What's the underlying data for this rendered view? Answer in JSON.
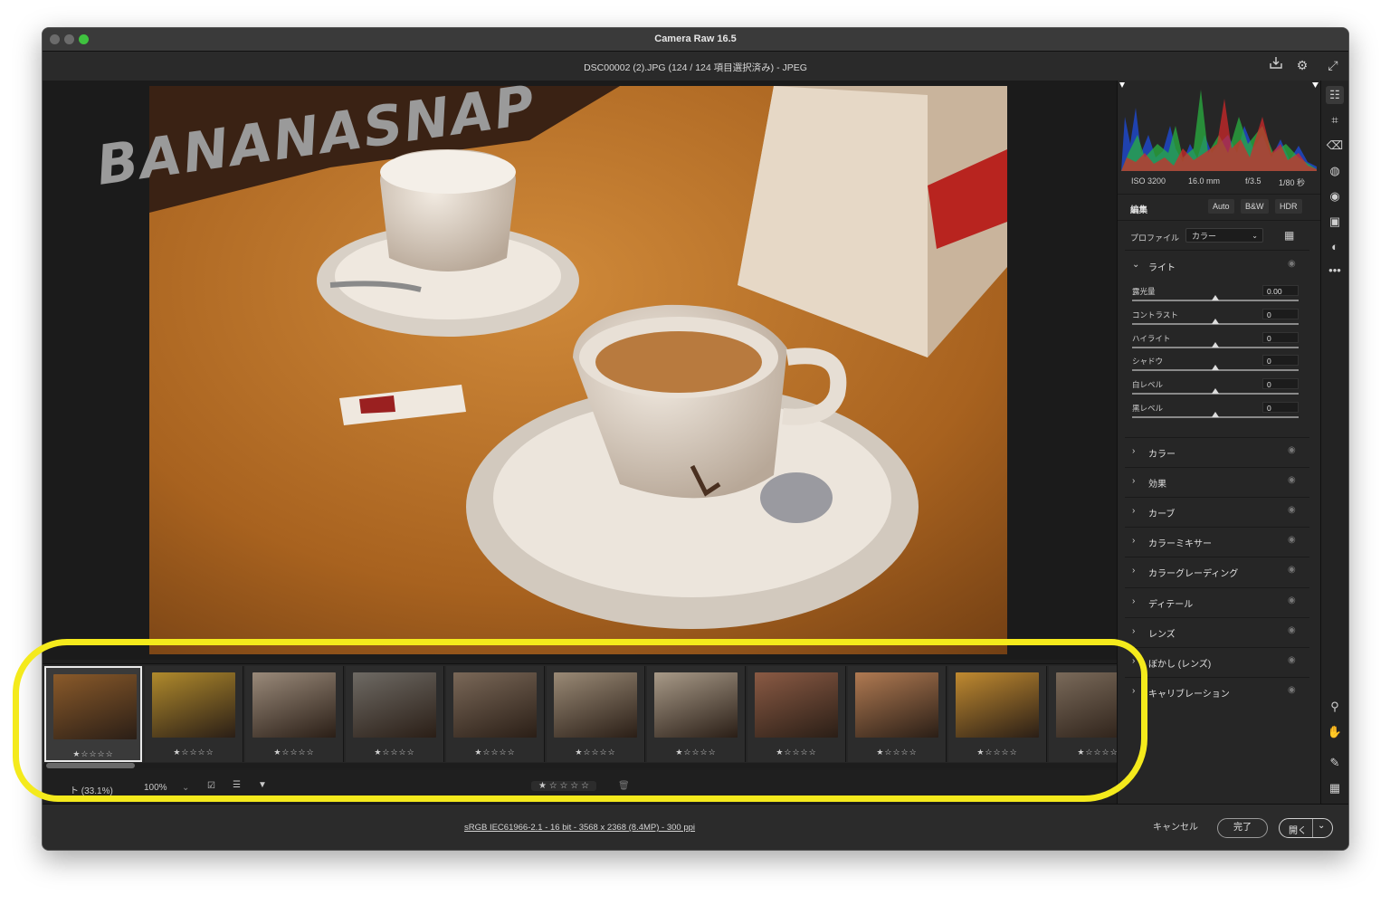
{
  "window": {
    "title": "Camera Raw 16.5",
    "filename": "DSC00002 (2).JPG (124 / 124 項目選択済み)  -  JPEG"
  },
  "watermark": "BANANASNAP",
  "filmstrip": {
    "thumbnails": [
      {
        "stars": "★☆☆☆☆",
        "color": "#8a5a2a",
        "selected": true
      },
      {
        "stars": "★☆☆☆☆",
        "color": "#b08a2c"
      },
      {
        "stars": "★☆☆☆☆",
        "color": "#9a8a7a"
      },
      {
        "stars": "★☆☆☆☆",
        "color": "#6e6a64"
      },
      {
        "stars": "★☆☆☆☆",
        "color": "#7a6858"
      },
      {
        "stars": "★☆☆☆☆",
        "color": "#9a8a76"
      },
      {
        "stars": "★☆☆☆☆",
        "color": "#a89a88"
      },
      {
        "stars": "★☆☆☆☆",
        "color": "#8a5a44"
      },
      {
        "stars": "★☆☆☆☆",
        "color": "#b07a52"
      },
      {
        "stars": "★☆☆☆☆",
        "color": "#c08a30"
      },
      {
        "stars": "★☆☆☆☆",
        "color": "#7a6a5a"
      }
    ]
  },
  "bottom": {
    "fit_zoom": "ト (33.1%)",
    "zoom": "100%",
    "rating": "★ ☆ ☆ ☆ ☆"
  },
  "footer": {
    "info": "sRGB IEC61966-2.1 - 16 bit - 3568 x 2368 (8.4MP) - 300 ppi",
    "cancel": "キャンセル",
    "done": "完了",
    "open": "開く"
  },
  "exif": {
    "iso": "ISO 3200",
    "focal": "16.0 mm",
    "aperture": "f/3.5",
    "shutter": "1/80 秒"
  },
  "edit": {
    "label": "編集",
    "auto": "Auto",
    "bw": "B&W",
    "hdr": "HDR"
  },
  "profile": {
    "label": "プロファイル",
    "value": "カラー"
  },
  "light": {
    "label": "ライト",
    "sliders": [
      {
        "label": "露光量",
        "value": "0.00"
      },
      {
        "label": "コントラスト",
        "value": "0"
      },
      {
        "label": "ハイライト",
        "value": "0"
      },
      {
        "label": "シャドウ",
        "value": "0"
      },
      {
        "label": "白レベル",
        "value": "0"
      },
      {
        "label": "黒レベル",
        "value": "0"
      }
    ]
  },
  "sections": [
    "カラー",
    "効果",
    "カーブ",
    "カラーミキサー",
    "カラーグレーディング",
    "ディテール",
    "レンズ",
    "ぼかし (レンズ)",
    "キャリブレーション"
  ],
  "colors": {
    "highlight": "#f4ea1c",
    "window_bg": "#1e1e1e",
    "panel_bg": "#262626"
  }
}
